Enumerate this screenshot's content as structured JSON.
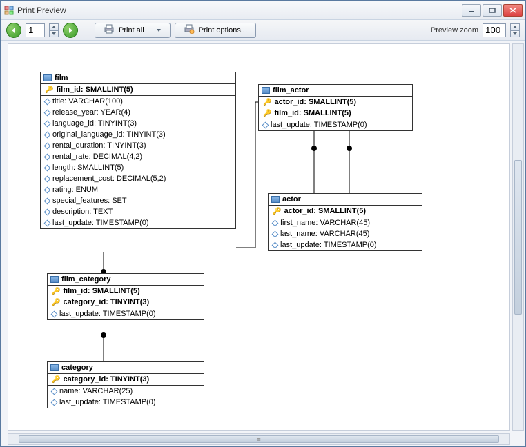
{
  "window": {
    "title": "Print Preview"
  },
  "toolbar": {
    "page_value": "1",
    "print_label": "Print all",
    "options_label": "Print options...",
    "zoom_label": "Preview zoom",
    "zoom_value": "100"
  },
  "entities": {
    "film": {
      "name": "film",
      "pk": [
        "film_id: SMALLINT(5)"
      ],
      "cols": [
        "title: VARCHAR(100)",
        "release_year: YEAR(4)",
        "language_id: TINYINT(3)",
        "original_language_id: TINYINT(3)",
        "rental_duration: TINYINT(3)",
        "rental_rate: DECIMAL(4,2)",
        "length: SMALLINT(5)",
        "replacement_cost: DECIMAL(5,2)",
        "rating: ENUM",
        "special_features: SET",
        "description: TEXT",
        "last_update: TIMESTAMP(0)"
      ]
    },
    "film_actor": {
      "name": "film_actor",
      "pk": [
        "actor_id: SMALLINT(5)",
        "film_id: SMALLINT(5)"
      ],
      "cols": [
        "last_update: TIMESTAMP(0)"
      ]
    },
    "actor": {
      "name": "actor",
      "pk": [
        "actor_id: SMALLINT(5)"
      ],
      "cols": [
        "first_name: VARCHAR(45)",
        "last_name: VARCHAR(45)",
        "last_update: TIMESTAMP(0)"
      ]
    },
    "film_category": {
      "name": "film_category",
      "pk": [
        "film_id: SMALLINT(5)",
        "category_id: TINYINT(3)"
      ],
      "cols": [
        "last_update: TIMESTAMP(0)"
      ]
    },
    "category": {
      "name": "category",
      "pk": [
        "category_id: TINYINT(3)"
      ],
      "cols": [
        "name: VARCHAR(25)",
        "last_update: TIMESTAMP(0)"
      ]
    }
  }
}
